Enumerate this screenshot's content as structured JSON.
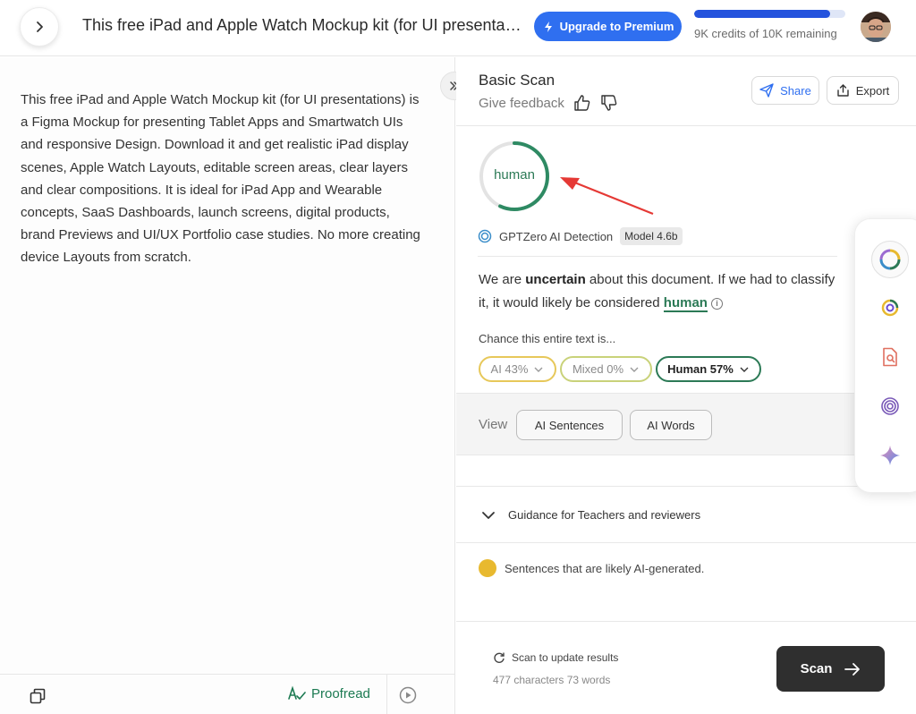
{
  "header": {
    "document_title": "This free iPad and Apple Watch Mockup kit (for UI presentations) is a Figma Mockup for presenting Tablet Apps",
    "premium_label": "Upgrade to Premium",
    "credits_text": "9K credits of 10K remaining",
    "credits_used_fraction": 0.1
  },
  "document": {
    "body": "This free iPad and Apple Watch Mockup kit (for UI presentations) is a Figma Mockup for presenting Tablet Apps and Smartwatch UIs and responsive Design. Download it and get realistic iPad display scenes, Apple Watch Layouts, editable screen areas, clear layers and clear compositions. It is ideal for iPad App and Wearable concepts, SaaS Dashboards, launch screens, digital products, brand Previews and UI/UX Portfolio case studies. No more creating device Layouts from scratch."
  },
  "left_footer": {
    "proofread_label": "Proofread"
  },
  "scan": {
    "title": "Basic Scan",
    "feedback_label": "Give feedback",
    "share_label": "Share",
    "export_label": "Export",
    "result_label": "human",
    "human_fraction": 0.57,
    "detector_name": "GPTZero AI Detection",
    "model_label": "Model 4.6b",
    "verdict_pre": "We are ",
    "verdict_bold": "uncertain",
    "verdict_mid": " about this document. If we had to classify it, it would likely be considered ",
    "verdict_class": "human",
    "chance_label": "Chance this entire text is...",
    "chips": {
      "ai": "AI 43%",
      "mixed": "Mixed 0%",
      "human": "Human 57%"
    },
    "view_label": "View",
    "view_ai_sentences": "AI Sentences",
    "view_ai_words": "AI Words",
    "guidance_label": "Guidance for Teachers and reviewers",
    "legend_text": "Sentences that are likely AI-generated.",
    "scan_update_text": "Scan to update results",
    "char_count_text": "477 characters 73 words",
    "scan_button": "Scan"
  },
  "colors": {
    "accent_blue": "#2f6ff0",
    "human_green": "#2c7a56",
    "ai_yellow": "#e8b92f"
  }
}
